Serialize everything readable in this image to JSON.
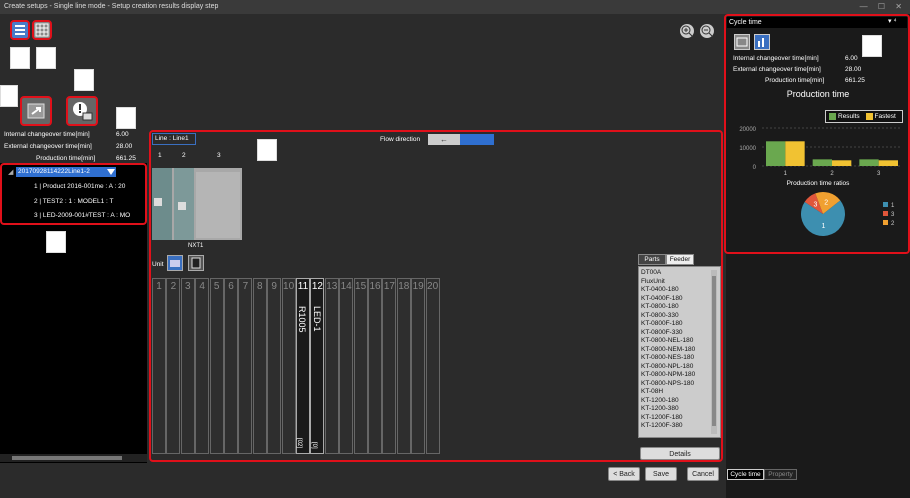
{
  "window": {
    "title": "Create setups - Single line mode - Setup creation results display step",
    "controls": "— ☐ ✕"
  },
  "stats": {
    "internal_label": "Internal changeover time[min]",
    "internal_value": "6.00",
    "external_label": "External changeover time[min]",
    "external_value": "28.00",
    "production_label": "Production time[min]",
    "production_value": "661.25"
  },
  "tree": {
    "root": "20170928114222Line1-2",
    "items": [
      "1 | Product 2016-001me : A : 20",
      "2 | TEST2 : 1 : MODEL1 : T",
      "3 | LED-2009-001#TEST : A : MO"
    ]
  },
  "line": {
    "label": "Line :",
    "name": "Line1",
    "modules": [
      "1",
      "2",
      "3"
    ],
    "machine": "NXT1",
    "flow_label": "Flow direction",
    "arrow": "←"
  },
  "unit": {
    "label": "Unit"
  },
  "slots": {
    "numbers": [
      "1",
      "2",
      "3",
      "4",
      "5",
      "6",
      "7",
      "8",
      "9",
      "10",
      "11",
      "12",
      "13",
      "14",
      "15",
      "16",
      "17",
      "18",
      "19",
      "20"
    ],
    "feeder11": "R1005",
    "feeder12": "LED-1",
    "tag11": "[02]",
    "tag12": "[0]"
  },
  "parts_panel": {
    "tabs": [
      "Parts",
      "Feeder"
    ],
    "items": [
      "DT00A",
      "FluxUnit",
      "KT-0400-180",
      "KT-0400F-180",
      "KT-0800-180",
      "KT-0800-330",
      "KT-0800F-180",
      "KT-0800F-330",
      "KT-0800-NEL-180",
      "KT-0800-NEM-180",
      "KT-0800-NES-180",
      "KT-0800-NPL-180",
      "KT-0800-NPM-180",
      "KT-0800-NPS-180",
      "KT-08H",
      "KT-1200-180",
      "KT-1200-380",
      "KT-1200F-180",
      "KT-1200F-380"
    ],
    "details_button": "Details"
  },
  "footer": {
    "back": "< Back",
    "save": "Save",
    "cancel": "Cancel"
  },
  "cycle": {
    "title": "Cycle time",
    "pin": "▾ ⁴",
    "chart_title": "Production time",
    "legend_results": "Results",
    "legend_fastest": "Fastest",
    "pie_title": "Production time ratios",
    "bottom_tabs": [
      "Cycle time",
      "Property"
    ]
  },
  "chart_data": [
    {
      "type": "bar",
      "title": "Production time",
      "categories": [
        "1",
        "2",
        "3"
      ],
      "yticks": [
        "20000",
        "10000",
        "0"
      ],
      "ylim": [
        0,
        20000
      ],
      "series": [
        {
          "name": "Results",
          "values": [
            13000,
            3500,
            3500
          ]
        },
        {
          "name": "Fastest",
          "values": [
            13000,
            3000,
            3000
          ]
        }
      ],
      "colors": [
        "#6aa84f",
        "#f1c232"
      ]
    },
    {
      "type": "pie",
      "title": "Production time ratios",
      "labels": [
        "1",
        "3",
        "2"
      ],
      "values": [
        70,
        10,
        20
      ],
      "colors": [
        "#3d8fb0",
        "#e0563b",
        "#f0a030"
      ]
    }
  ]
}
